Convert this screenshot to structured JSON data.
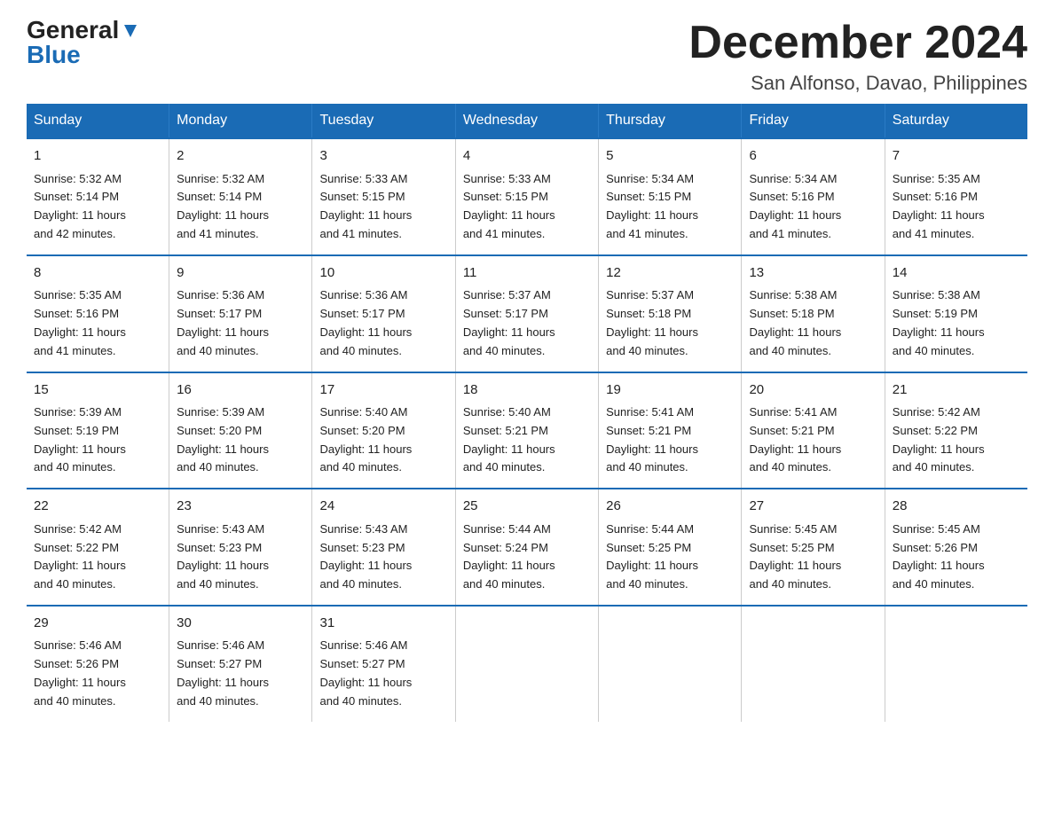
{
  "logo": {
    "general": "General",
    "blue": "Blue"
  },
  "title": {
    "main": "December 2024",
    "sub": "San Alfonso, Davao, Philippines"
  },
  "headers": [
    "Sunday",
    "Monday",
    "Tuesday",
    "Wednesday",
    "Thursday",
    "Friday",
    "Saturday"
  ],
  "weeks": [
    [
      {
        "day": "1",
        "info": "Sunrise: 5:32 AM\nSunset: 5:14 PM\nDaylight: 11 hours\nand 42 minutes."
      },
      {
        "day": "2",
        "info": "Sunrise: 5:32 AM\nSunset: 5:14 PM\nDaylight: 11 hours\nand 41 minutes."
      },
      {
        "day": "3",
        "info": "Sunrise: 5:33 AM\nSunset: 5:15 PM\nDaylight: 11 hours\nand 41 minutes."
      },
      {
        "day": "4",
        "info": "Sunrise: 5:33 AM\nSunset: 5:15 PM\nDaylight: 11 hours\nand 41 minutes."
      },
      {
        "day": "5",
        "info": "Sunrise: 5:34 AM\nSunset: 5:15 PM\nDaylight: 11 hours\nand 41 minutes."
      },
      {
        "day": "6",
        "info": "Sunrise: 5:34 AM\nSunset: 5:16 PM\nDaylight: 11 hours\nand 41 minutes."
      },
      {
        "day": "7",
        "info": "Sunrise: 5:35 AM\nSunset: 5:16 PM\nDaylight: 11 hours\nand 41 minutes."
      }
    ],
    [
      {
        "day": "8",
        "info": "Sunrise: 5:35 AM\nSunset: 5:16 PM\nDaylight: 11 hours\nand 41 minutes."
      },
      {
        "day": "9",
        "info": "Sunrise: 5:36 AM\nSunset: 5:17 PM\nDaylight: 11 hours\nand 40 minutes."
      },
      {
        "day": "10",
        "info": "Sunrise: 5:36 AM\nSunset: 5:17 PM\nDaylight: 11 hours\nand 40 minutes."
      },
      {
        "day": "11",
        "info": "Sunrise: 5:37 AM\nSunset: 5:17 PM\nDaylight: 11 hours\nand 40 minutes."
      },
      {
        "day": "12",
        "info": "Sunrise: 5:37 AM\nSunset: 5:18 PM\nDaylight: 11 hours\nand 40 minutes."
      },
      {
        "day": "13",
        "info": "Sunrise: 5:38 AM\nSunset: 5:18 PM\nDaylight: 11 hours\nand 40 minutes."
      },
      {
        "day": "14",
        "info": "Sunrise: 5:38 AM\nSunset: 5:19 PM\nDaylight: 11 hours\nand 40 minutes."
      }
    ],
    [
      {
        "day": "15",
        "info": "Sunrise: 5:39 AM\nSunset: 5:19 PM\nDaylight: 11 hours\nand 40 minutes."
      },
      {
        "day": "16",
        "info": "Sunrise: 5:39 AM\nSunset: 5:20 PM\nDaylight: 11 hours\nand 40 minutes."
      },
      {
        "day": "17",
        "info": "Sunrise: 5:40 AM\nSunset: 5:20 PM\nDaylight: 11 hours\nand 40 minutes."
      },
      {
        "day": "18",
        "info": "Sunrise: 5:40 AM\nSunset: 5:21 PM\nDaylight: 11 hours\nand 40 minutes."
      },
      {
        "day": "19",
        "info": "Sunrise: 5:41 AM\nSunset: 5:21 PM\nDaylight: 11 hours\nand 40 minutes."
      },
      {
        "day": "20",
        "info": "Sunrise: 5:41 AM\nSunset: 5:21 PM\nDaylight: 11 hours\nand 40 minutes."
      },
      {
        "day": "21",
        "info": "Sunrise: 5:42 AM\nSunset: 5:22 PM\nDaylight: 11 hours\nand 40 minutes."
      }
    ],
    [
      {
        "day": "22",
        "info": "Sunrise: 5:42 AM\nSunset: 5:22 PM\nDaylight: 11 hours\nand 40 minutes."
      },
      {
        "day": "23",
        "info": "Sunrise: 5:43 AM\nSunset: 5:23 PM\nDaylight: 11 hours\nand 40 minutes."
      },
      {
        "day": "24",
        "info": "Sunrise: 5:43 AM\nSunset: 5:23 PM\nDaylight: 11 hours\nand 40 minutes."
      },
      {
        "day": "25",
        "info": "Sunrise: 5:44 AM\nSunset: 5:24 PM\nDaylight: 11 hours\nand 40 minutes."
      },
      {
        "day": "26",
        "info": "Sunrise: 5:44 AM\nSunset: 5:25 PM\nDaylight: 11 hours\nand 40 minutes."
      },
      {
        "day": "27",
        "info": "Sunrise: 5:45 AM\nSunset: 5:25 PM\nDaylight: 11 hours\nand 40 minutes."
      },
      {
        "day": "28",
        "info": "Sunrise: 5:45 AM\nSunset: 5:26 PM\nDaylight: 11 hours\nand 40 minutes."
      }
    ],
    [
      {
        "day": "29",
        "info": "Sunrise: 5:46 AM\nSunset: 5:26 PM\nDaylight: 11 hours\nand 40 minutes."
      },
      {
        "day": "30",
        "info": "Sunrise: 5:46 AM\nSunset: 5:27 PM\nDaylight: 11 hours\nand 40 minutes."
      },
      {
        "day": "31",
        "info": "Sunrise: 5:46 AM\nSunset: 5:27 PM\nDaylight: 11 hours\nand 40 minutes."
      },
      {
        "day": "",
        "info": ""
      },
      {
        "day": "",
        "info": ""
      },
      {
        "day": "",
        "info": ""
      },
      {
        "day": "",
        "info": ""
      }
    ]
  ]
}
